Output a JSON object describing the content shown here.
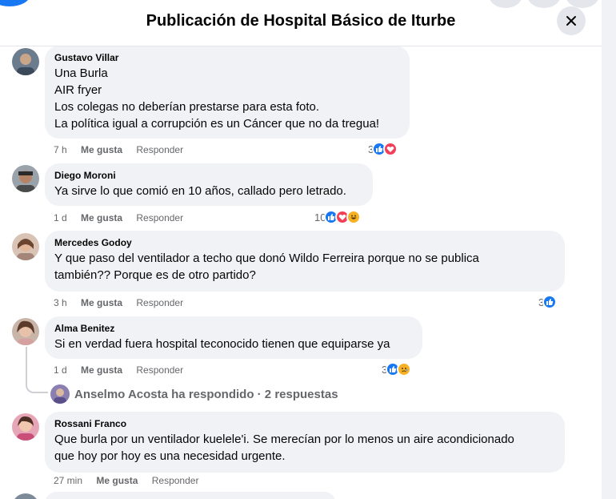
{
  "header": {
    "title": "Publicación de Hospital Básico de Iturbe"
  },
  "comments": [
    {
      "author": "Gustavo Villar",
      "lines": [
        "Una Burla",
        "AIR fryer",
        "Los colegas no deberían prestarse para esta foto.",
        "La política igual a corrupción es un Cáncer que no da tregua!"
      ],
      "time": "7 h",
      "like": "Me gusta",
      "reply": "Responder",
      "reaction_count": "3",
      "reactions": [
        "like-icon",
        "love-icon"
      ]
    },
    {
      "author": "Diego Moroni",
      "lines": [
        "Ya sirve lo que comió en 10 años, callado pero letrado."
      ],
      "time": "1 d",
      "like": "Me gusta",
      "reply": "Responder",
      "reaction_count": "10",
      "reactions": [
        "like-icon",
        "love-icon",
        "haha-icon"
      ]
    },
    {
      "author": "Mercedes Godoy",
      "lines": [
        "Y que paso del ventilador a techo que donó Wildo Ferreira porque no se publica",
        "también?? Porque es de otro partido?"
      ],
      "time": "3 h",
      "like": "Me gusta",
      "reply": "Responder",
      "reaction_count": "3",
      "reactions": [
        "like-icon"
      ]
    },
    {
      "author": "Alma Benitez",
      "lines": [
        "Si en verdad fuera hospital teconocido tienen que equiparse ya"
      ],
      "time": "1 d",
      "like": "Me gusta",
      "reply": "Responder",
      "reaction_count": "3",
      "reactions": [
        "like-icon",
        "sad-icon"
      ]
    },
    {
      "author": "Rossani Franco",
      "lines": [
        "Que burla por un ventilador kuelele'i. Se merecían por lo menos un aire acondicionado",
        "que hoy por hoy es una necesidad urgente."
      ],
      "time": "27 min",
      "like": "Me gusta",
      "reply": "Responder"
    }
  ],
  "replies_summary": {
    "text": "Anselmo Acosta ha respondido · 2 respuestas"
  },
  "colors": {
    "facebook_blue": "#1877f2",
    "bubble_gray": "#f0f2f5",
    "secondary_text": "#65676b",
    "love_red": "#f33e58",
    "emoji_yellow": "#f7b125"
  }
}
